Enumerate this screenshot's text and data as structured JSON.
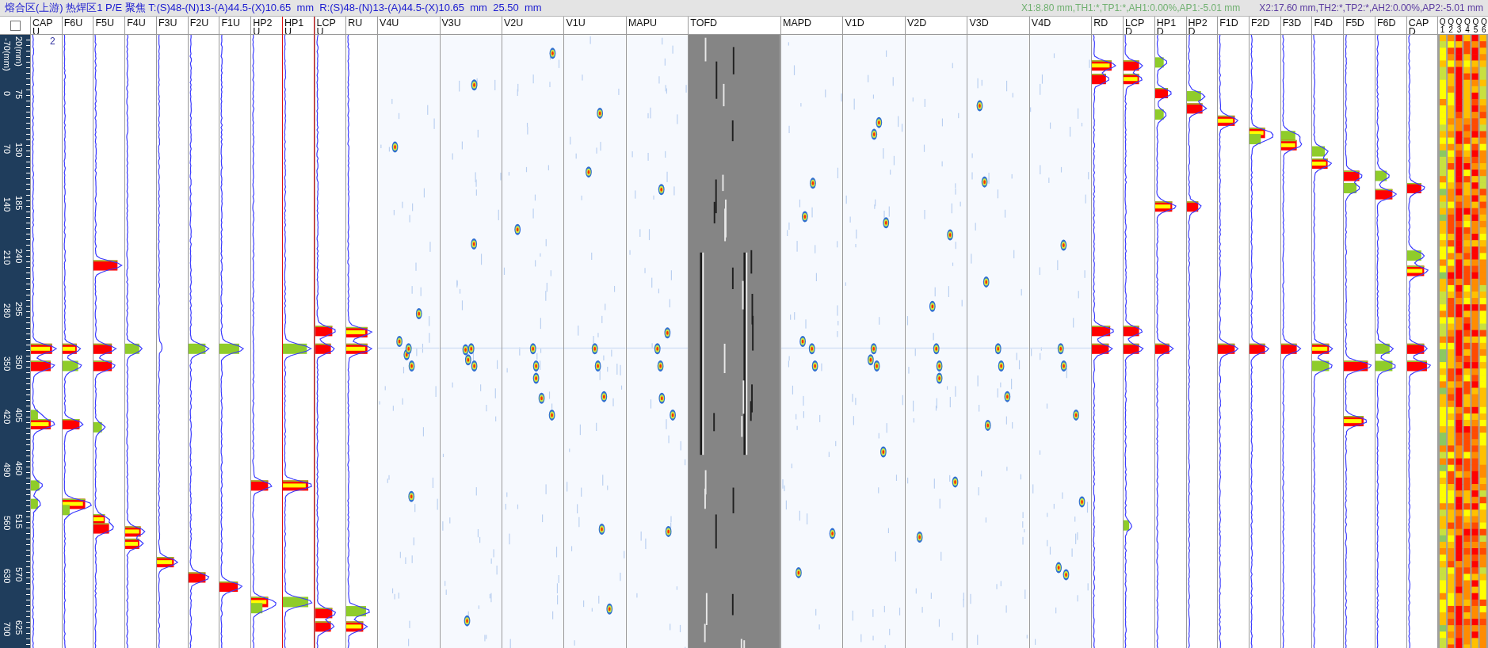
{
  "title_bar": {
    "title": "熔合区(上游) 热焊区1 P/E 聚焦 T:(S)48-(N)13-(A)44.5-(X)10.65  mm  R:(S)48-(N)13-(A)44.5-(X)10.65  mm  25.50  mm",
    "cursor_1": "X1:8.80 mm,TH1:*,TP1:*,AH1:0.00%,AP1:-5.01 mm",
    "cursor_2": "X2:17.60 mm,TH2:*,TP2:*,AH2:0.00%,AP2:-5.01 mm"
  },
  "select_all": {
    "checked": false
  },
  "ruler": {
    "outer_labels": [
      "-70(mm)",
      "0",
      "70",
      "140",
      "210",
      "280",
      "350",
      "420",
      "490",
      "560",
      "630",
      "700"
    ],
    "inner_labels": [
      "20(mm)",
      "75",
      "130",
      "185",
      "240",
      "295",
      "350",
      "405",
      "460",
      "515",
      "570",
      "625"
    ]
  },
  "channels": [
    {
      "label": "CAP U",
      "kind": "strip",
      "selected": false,
      "count": "2"
    },
    {
      "label": "F6U",
      "kind": "strip",
      "selected": false
    },
    {
      "label": "F5U",
      "kind": "strip",
      "selected": false
    },
    {
      "label": "F4U",
      "kind": "strip",
      "selected": false
    },
    {
      "label": "F3U",
      "kind": "strip",
      "selected": false
    },
    {
      "label": "F2U",
      "kind": "strip",
      "selected": false
    },
    {
      "label": "F1U",
      "kind": "strip",
      "selected": false
    },
    {
      "label": "HP2 U",
      "kind": "strip",
      "selected": false
    },
    {
      "label": "HP1 U",
      "kind": "strip",
      "selected": true
    },
    {
      "label": "LCP U",
      "kind": "strip",
      "selected": false
    },
    {
      "label": "RU",
      "kind": "strip",
      "selected": false
    },
    {
      "label": "V4U",
      "kind": "cscan",
      "selected": false
    },
    {
      "label": "V3U",
      "kind": "cscan",
      "selected": false
    },
    {
      "label": "V2U",
      "kind": "cscan",
      "selected": false
    },
    {
      "label": "V1U",
      "kind": "cscan",
      "selected": false
    },
    {
      "label": "MAPU",
      "kind": "cscan",
      "selected": false
    },
    {
      "label": "TOFD",
      "kind": "tofd",
      "selected": false
    },
    {
      "label": "MAPD",
      "kind": "cscan",
      "selected": false
    },
    {
      "label": "V1D",
      "kind": "cscan",
      "selected": false
    },
    {
      "label": "V2D",
      "kind": "cscan",
      "selected": false
    },
    {
      "label": "V3D",
      "kind": "cscan",
      "selected": false
    },
    {
      "label": "V4D",
      "kind": "cscan",
      "selected": false
    },
    {
      "label": "RD",
      "kind": "strip",
      "selected": false
    },
    {
      "label": "LCP D",
      "kind": "strip",
      "selected": false
    },
    {
      "label": "HP1 D",
      "kind": "strip",
      "selected": false
    },
    {
      "label": "HP2 D",
      "kind": "strip",
      "selected": false
    },
    {
      "label": "F1D",
      "kind": "strip",
      "selected": false
    },
    {
      "label": "F2D",
      "kind": "strip",
      "selected": false
    },
    {
      "label": "F3D",
      "kind": "strip",
      "selected": false
    },
    {
      "label": "F4D",
      "kind": "strip",
      "selected": false
    },
    {
      "label": "F5D",
      "kind": "strip",
      "selected": false
    },
    {
      "label": "F6D",
      "kind": "strip",
      "selected": false
    },
    {
      "label": "CAP D",
      "kind": "strip",
      "selected": false
    }
  ],
  "heatmap": {
    "labels": [
      "Q 1",
      "Q 2",
      "Q 3",
      "Q 4",
      "Q 5",
      "Q 6"
    ]
  }
}
